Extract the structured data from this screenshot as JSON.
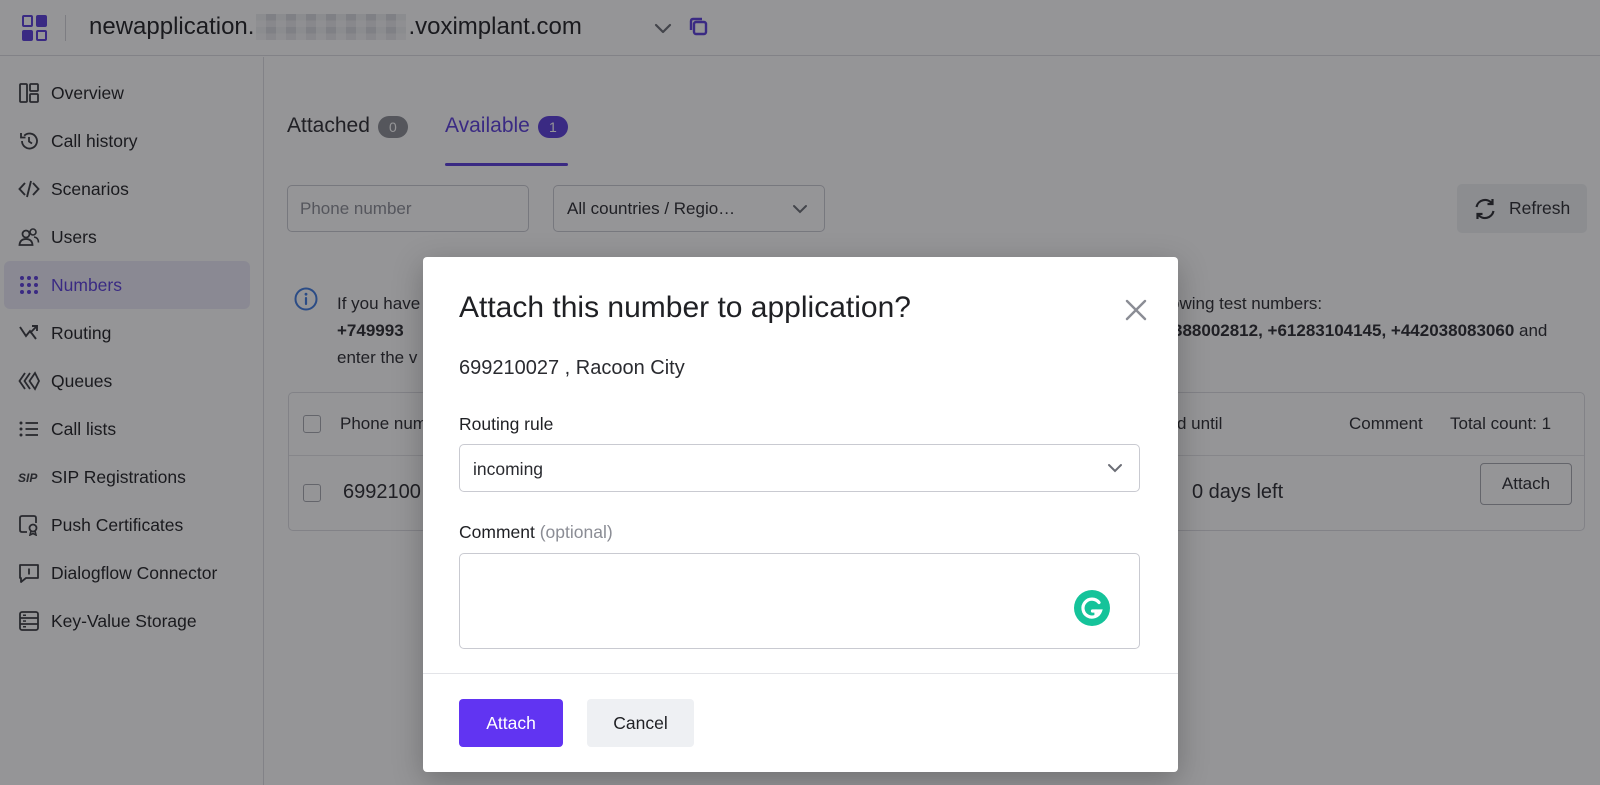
{
  "header": {
    "domain_prefix": "newapplication.",
    "domain_suffix": ".voximplant.com",
    "apps_icon": "apps-grid-icon",
    "dropdown_icon": "chevron-down-icon",
    "copy_icon": "copy-icon"
  },
  "sidebar": {
    "items": [
      {
        "label": "Overview",
        "icon": "overview-icon"
      },
      {
        "label": "Call history",
        "icon": "history-icon"
      },
      {
        "label": "Scenarios",
        "icon": "code-icon"
      },
      {
        "label": "Users",
        "icon": "users-icon"
      },
      {
        "label": "Numbers",
        "icon": "dialpad-icon",
        "active": true
      },
      {
        "label": "Routing",
        "icon": "routing-icon"
      },
      {
        "label": "Queues",
        "icon": "queues-icon"
      },
      {
        "label": "Call lists",
        "icon": "list-icon"
      },
      {
        "label": "SIP Registrations",
        "icon": "sip-icon"
      },
      {
        "label": "Push Certificates",
        "icon": "certificate-icon"
      },
      {
        "label": "Dialogflow Connector",
        "icon": "chat-icon"
      },
      {
        "label": "Key-Value Storage",
        "icon": "storage-icon"
      }
    ]
  },
  "tabs": [
    {
      "label": "Attached",
      "count": "0"
    },
    {
      "label": "Available",
      "count": "1",
      "active": true
    }
  ],
  "filters": {
    "phone_placeholder": "Phone number",
    "country_selected": "All countries / Regio…",
    "refresh_label": "Refresh"
  },
  "info": {
    "line1_start": "If you have",
    "line1_end": "owing test numbers:",
    "line2_start": "+749993",
    "line2_end": "388002812, +61283104145, +442038083060",
    "line2_tail": " and",
    "line3_start": "enter the v"
  },
  "table": {
    "headers": {
      "phone": "Phone num",
      "paid_until": "d until",
      "comment": "Comment",
      "total": "Total count: 1"
    },
    "rows": [
      {
        "phone": "6992100",
        "paid_until": "0 days left",
        "action": "Attach"
      }
    ]
  },
  "modal": {
    "title": "Attach this number to application?",
    "subtitle": "699210027 , Racoon City",
    "routing_label": "Routing rule",
    "routing_value": "incoming",
    "comment_label": "Comment",
    "comment_optional": "(optional)",
    "comment_value": "",
    "attach_label": "Attach",
    "cancel_label": "Cancel"
  },
  "colors": {
    "accent": "#5a3ddb",
    "primary_button": "#6134f2",
    "grammarly": "#15c39a"
  }
}
